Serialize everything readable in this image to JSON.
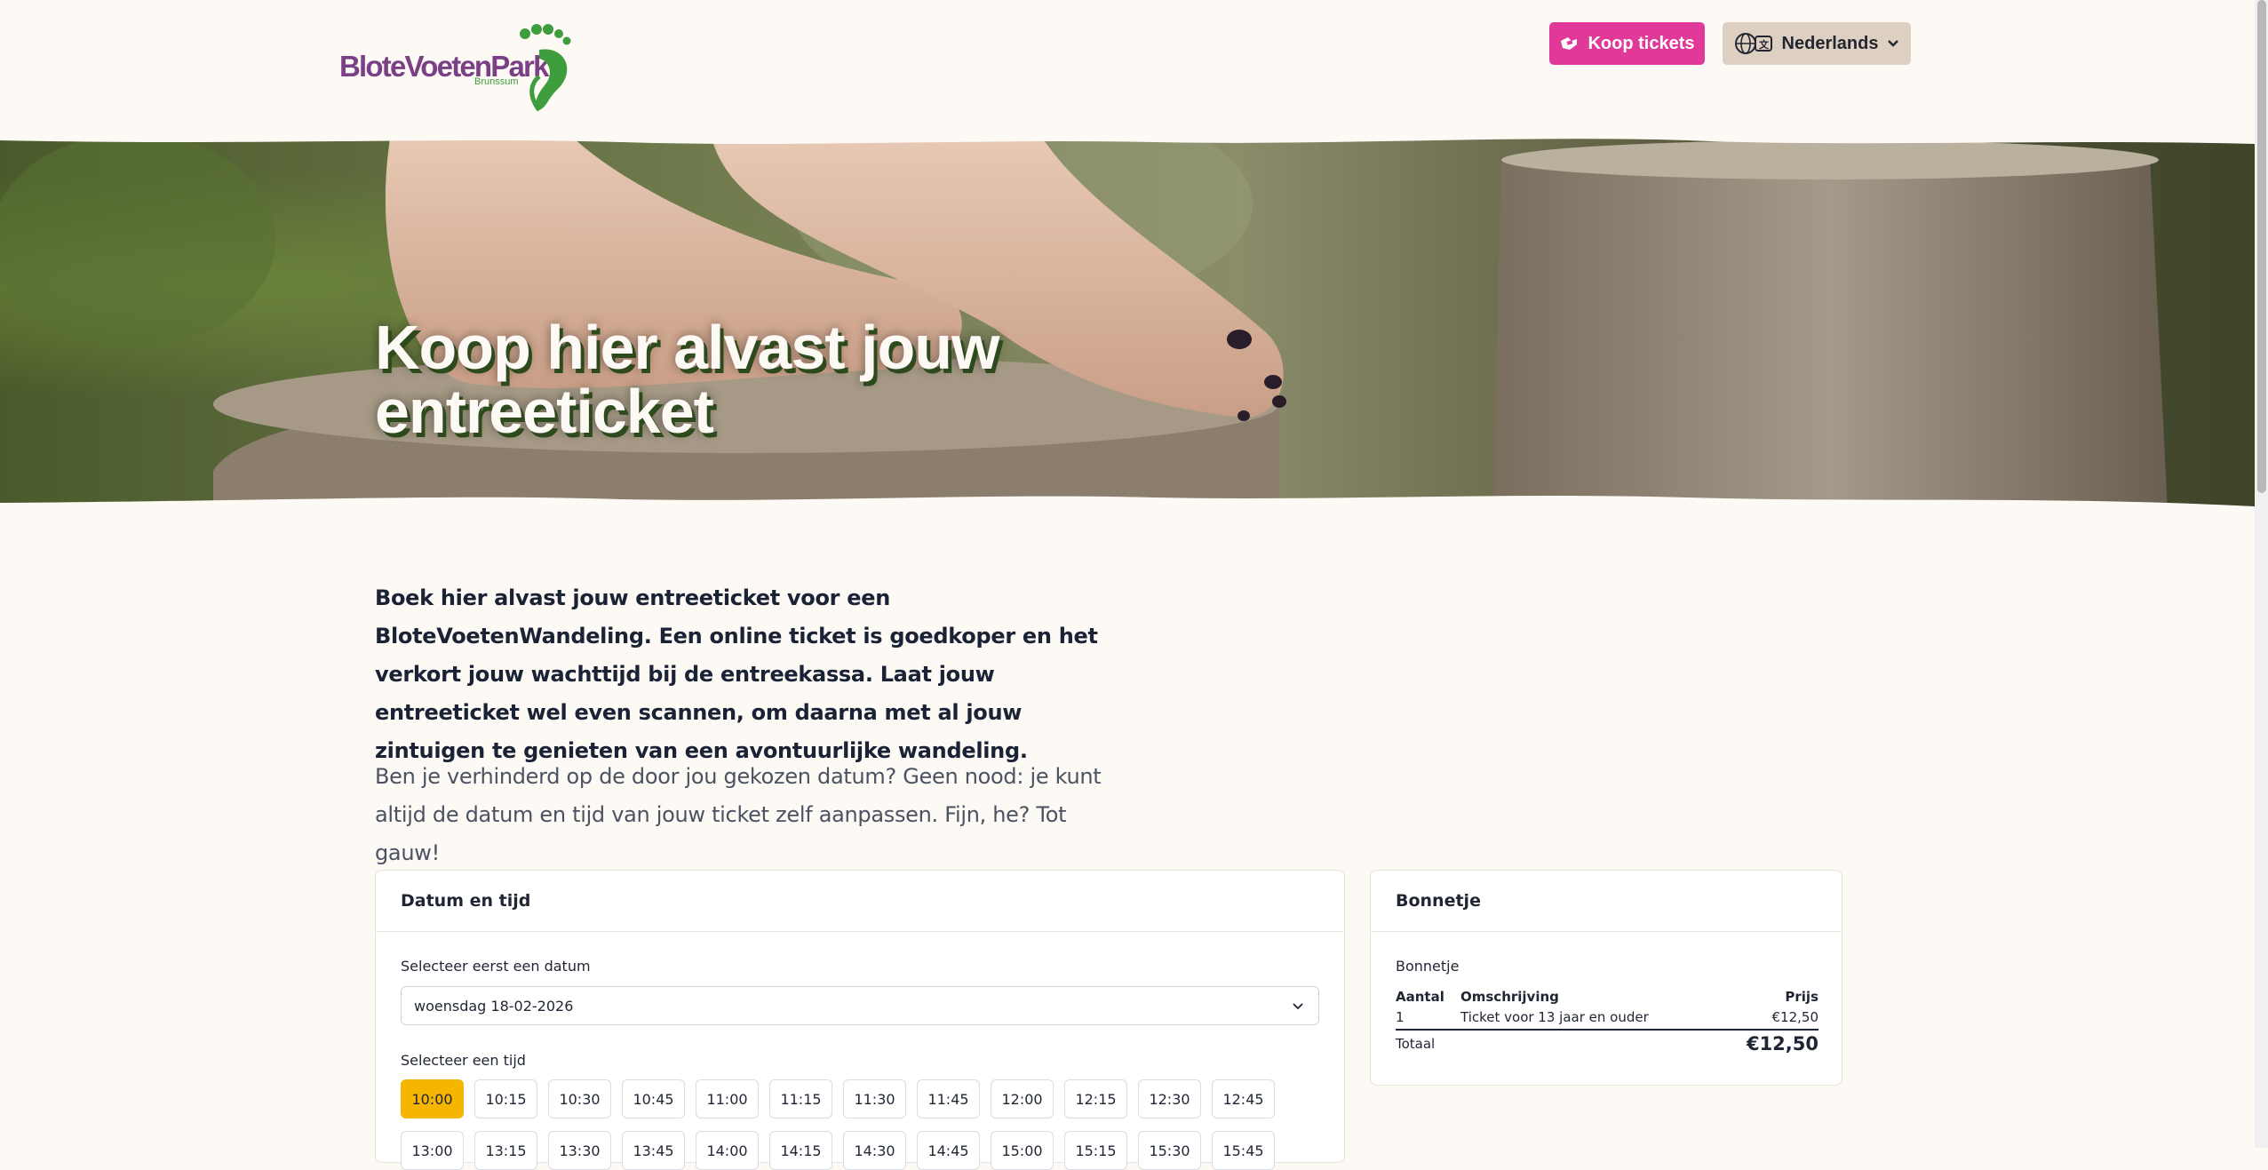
{
  "header": {
    "logo": {
      "word1": "Blote",
      "word2": "Voeten",
      "word3": "Park",
      "sub": "Brunssum"
    },
    "buy_tickets_label": "Koop tickets",
    "language_label": "Nederlands"
  },
  "hero": {
    "title_line1": "Koop hier alvast jouw",
    "title_line2": "entreeticket"
  },
  "intro": {
    "bold": "Boek hier alvast jouw entreeticket voor een BloteVoetenWandeling. Een online ticket is goedkoper en het verkort jouw wachttijd bij de entreekassa. Laat jouw entreeticket wel even scannen, om daarna met al jouw zintuigen te genieten van een avontuurlijke wandeling.",
    "regular": "Ben je verhinderd op de door jou gekozen datum? Geen nood: je kunt altijd de datum en tijd van jouw ticket zelf aanpassen. Fijn, he? Tot gauw!"
  },
  "date_card": {
    "title": "Datum en tijd",
    "date_label": "Selecteer eerst een datum",
    "date_value": "woensdag 18-02-2026",
    "time_label": "Selecteer een tijd",
    "times_row1": [
      "10:00",
      "10:15",
      "10:30",
      "10:45",
      "11:00",
      "11:15",
      "11:30",
      "11:45",
      "12:00",
      "12:15",
      "12:30",
      "12:45"
    ],
    "times_row2": [
      "13:00",
      "13:15",
      "13:30",
      "13:45",
      "14:00",
      "14:15",
      "14:30",
      "14:45",
      "15:00",
      "15:15",
      "15:30",
      "15:45"
    ],
    "selected_time": "10:00"
  },
  "receipt": {
    "title": "Bonnetje",
    "subtitle": "Bonnetje",
    "headers": {
      "qty": "Aantal",
      "desc": "Omschrijving",
      "price": "Prijs"
    },
    "line": {
      "qty": "1",
      "desc": "Ticket voor 13 jaar en ouder",
      "price": "€12,50"
    },
    "total_label": "Totaal",
    "total_value": "€12,50"
  },
  "colors": {
    "accent_pink": "#e0399a",
    "selected_time": "#f5b500",
    "brand_purple": "#7b3f86",
    "brand_green": "#3e9d3c"
  }
}
